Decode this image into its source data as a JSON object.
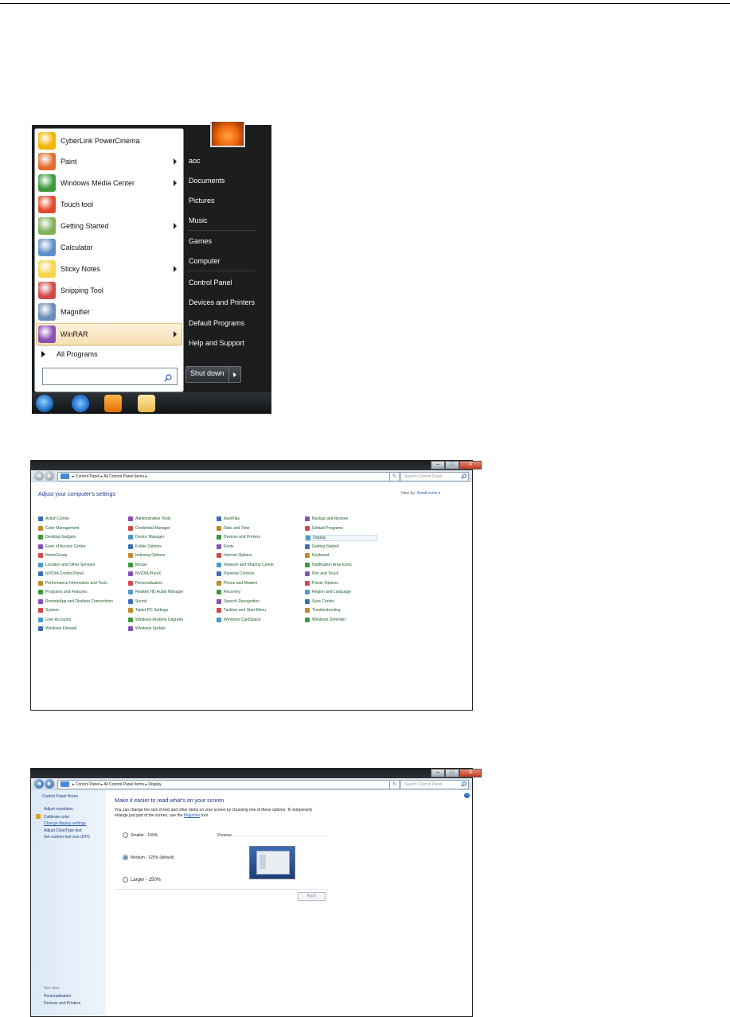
{
  "start_menu": {
    "items": [
      {
        "label": "CyberLink PowerCinema",
        "arrow": false,
        "icon_color": "#f2b600"
      },
      {
        "label": "Paint",
        "arrow": true,
        "icon_color": "#e46c2e"
      },
      {
        "label": "Windows Media Center",
        "arrow": true,
        "icon_color": "#3c9a3c"
      },
      {
        "label": "Touch tool",
        "arrow": false,
        "icon_color": "#e24a2a"
      },
      {
        "label": "Getting Started",
        "arrow": true,
        "icon_color": "#7fb15a"
      },
      {
        "label": "Calculator",
        "arrow": false,
        "icon_color": "#5f8fc9"
      },
      {
        "label": "Sticky Notes",
        "arrow": true,
        "icon_color": "#f4d64a"
      },
      {
        "label": "Snipping Tool",
        "arrow": false,
        "icon_color": "#d04a4a"
      },
      {
        "label": "Magnifier",
        "arrow": false,
        "icon_color": "#6a8cb8"
      },
      {
        "label": "WinRAR",
        "arrow": true,
        "icon_color": "#8a4fb5",
        "highlighted": true
      }
    ],
    "all_programs": "All Programs",
    "search_value": "",
    "right_items": [
      {
        "label": "aoc",
        "sep_after": false
      },
      {
        "label": "Documents",
        "sep_after": false
      },
      {
        "label": "Pictures",
        "sep_after": false
      },
      {
        "label": "Music",
        "sep_after": true
      },
      {
        "label": "Games",
        "sep_after": false
      },
      {
        "label": "Computer",
        "sep_after": true
      },
      {
        "label": "Control Panel",
        "sep_after": false
      },
      {
        "label": "Devices and Printers",
        "sep_after": false
      },
      {
        "label": "Default Programs",
        "sep_after": false
      },
      {
        "label": "Help and Support",
        "sep_after": false
      }
    ],
    "shutdown_label": "Shut down"
  },
  "control_panel": {
    "window_buttons": {
      "min": "–",
      "max": "□",
      "close": "X"
    },
    "breadcrumb": "▸ Control Panel ▸ All Control Panel Items ▸",
    "search_placeholder": "Search Control Panel",
    "heading": "Adjust your computer's settings",
    "view_by_label": "View by:",
    "view_by_value": "Small icons ▾",
    "columns": [
      [
        "Action Center",
        "Color Management",
        "Desktop Gadgets",
        "Ease of Access Center",
        "HomeGroup",
        "Location and Other Sensors",
        "NVIDIA Control Panel",
        "Performance Information and Tools",
        "Programs and Features",
        "RemoteApp and Desktop Connections",
        "System",
        "User Accounts",
        "Windows Firewall"
      ],
      [
        "Administrative Tools",
        "Credential Manager",
        "Device Manager",
        "Folder Options",
        "Indexing Options",
        "Mouse",
        "NVIDIA PhysX",
        "Personalization",
        "Realtek HD Audio Manager",
        "Sound",
        "Tablet PC Settings",
        "Windows Anytime Upgrade",
        "Windows Update"
      ],
      [
        "AutoPlay",
        "Date and Time",
        "Devices and Printers",
        "Fonts",
        "Internet Options",
        "Network and Sharing Center",
        "Parental Controls",
        "Phone and Modem",
        "Recovery",
        "Speech Recognition",
        "Taskbar and Start Menu",
        "Windows CardSpace"
      ],
      [
        "Backup and Restore",
        "Default Programs",
        "Display",
        "Getting Started",
        "Keyboard",
        "Notification Area Icons",
        "Pen and Touch",
        "Power Options",
        "Region and Language",
        "Sync Center",
        "Troubleshooting",
        "Windows Defender"
      ]
    ],
    "selected_item": "Display"
  },
  "display": {
    "window_buttons": {
      "min": "–",
      "max": "□",
      "close": "X"
    },
    "breadcrumb": "▸ Control Panel ▸ All Control Panel Items ▸ Display",
    "search_placeholder": "Search Control Panel",
    "help": "?",
    "left_links": [
      {
        "label": "Control Panel Home",
        "style": "normal"
      },
      {
        "label": "Adjust resolution",
        "style": "normal"
      },
      {
        "label": "Calibrate color",
        "style": "normal"
      },
      {
        "label": "Change display settings",
        "style": "underline"
      },
      {
        "label": "Adjust ClearType text",
        "style": "normal"
      },
      {
        "label": "Set custom text size (DPI)",
        "style": "normal"
      }
    ],
    "see_also_label": "See also",
    "see_also": [
      "Personalization",
      "Devices and Printers"
    ],
    "heading": "Make it easier to read what's on your screen",
    "description": "You can change the size of text and other items on your screen by choosing one of these options. To temporarily enlarge just part of the screen, use the",
    "magnifier_link": "Magnifier",
    "description_end": "tool.",
    "options": [
      {
        "label": "Smaller - 100%",
        "checked": false
      },
      {
        "label": "Medium - 125% (default)",
        "checked": true
      },
      {
        "label": "Larger - 150%",
        "checked": false
      }
    ],
    "preview_label": "Preview",
    "apply_label": "Apply"
  },
  "colors": {
    "link_green": "#1e5c2e",
    "heading_blue": "#1e3287",
    "highlight": "#f9dfb2"
  }
}
